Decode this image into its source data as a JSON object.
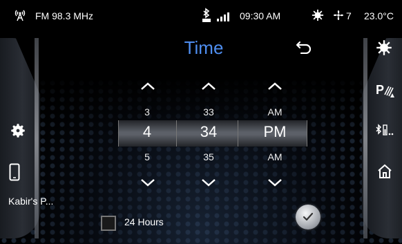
{
  "status_bar": {
    "radio": "FM 98.3 MHz",
    "time": "09:30 AM",
    "fan_speed": "7",
    "temperature": "23.0°C"
  },
  "header": {
    "title": "Time"
  },
  "picker": {
    "hours": {
      "prev": "3",
      "selected": "4",
      "next": "5"
    },
    "minutes": {
      "prev": "33",
      "selected": "34",
      "next": "35"
    },
    "period": {
      "prev": "AM",
      "selected": "PM",
      "next": "AM"
    }
  },
  "options": {
    "format_24h_label": "24 Hours",
    "format_24h_checked": false
  },
  "left_panel": {
    "device_name": "Kabir's P..."
  },
  "icons": {
    "status": [
      "radio-signal-icon",
      "bluetooth-icon",
      "signal-bars-icon",
      "climate-icon",
      "fan-icon"
    ],
    "left": [
      "settings-icon",
      "phone-icon"
    ],
    "right": [
      "climate-icon",
      "parking-sensor-icon",
      "bluetooth-battery-icon",
      "home-icon"
    ]
  },
  "colors": {
    "title": "#4f8ef0",
    "background": "#000000"
  }
}
